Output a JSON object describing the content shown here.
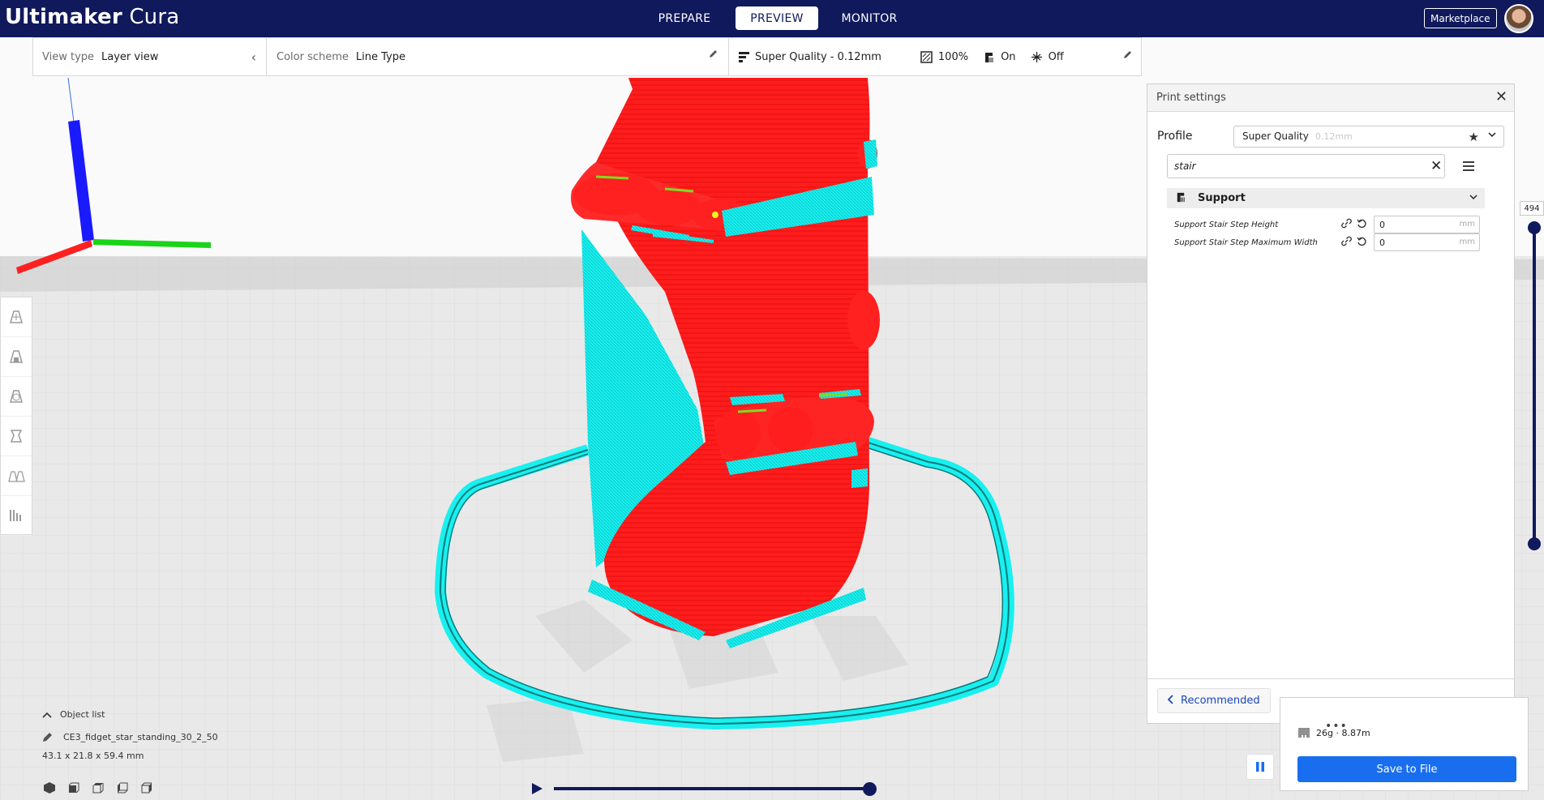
{
  "app": {
    "title_bold": "Ultimaker",
    "title_light": " Cura"
  },
  "stages": [
    {
      "label": "PREPARE",
      "active": false
    },
    {
      "label": "PREVIEW",
      "active": true
    },
    {
      "label": "MONITOR",
      "active": false
    }
  ],
  "header": {
    "marketplace_label": "Marketplace"
  },
  "view_bar": {
    "view_type_label": "View type",
    "view_type_value": "Layer view",
    "color_scheme_label": "Color scheme",
    "color_scheme_value": "Line Type"
  },
  "quality_bar": {
    "profile": "Super Quality - 0.12mm",
    "infill": "100%",
    "support": "On",
    "adhesion": "Off"
  },
  "print_settings": {
    "title": "Print settings",
    "profile_label": "Profile",
    "profile_value": "Super Quality",
    "profile_sub": "0.12mm",
    "search_value": "stair",
    "category": "Support",
    "settings": [
      {
        "label": "Support Stair Step Height",
        "value": "0",
        "unit": "mm"
      },
      {
        "label": "Support Stair Step Maximum Width",
        "value": "0",
        "unit": "mm"
      }
    ],
    "recommended_label": "Recommended"
  },
  "output": {
    "estimate": "26g · 8.87m",
    "save_label": "Save to File",
    "grip": "•••"
  },
  "layer_slider": {
    "value": "494",
    "position": 1.0
  },
  "playback": {
    "position": 1.0
  },
  "object_list": {
    "header": "Object list",
    "object_name": "CE3_fidget_star_standing_30_2_50",
    "dimensions": "43.1 x 21.8 x 59.4 mm"
  },
  "colors": {
    "header_bg": "#10195c",
    "model_wall": "#ff1c1c",
    "support": "#19f0f0",
    "infill_accent": "#7ddc1f",
    "primary_button": "#196ef0"
  }
}
